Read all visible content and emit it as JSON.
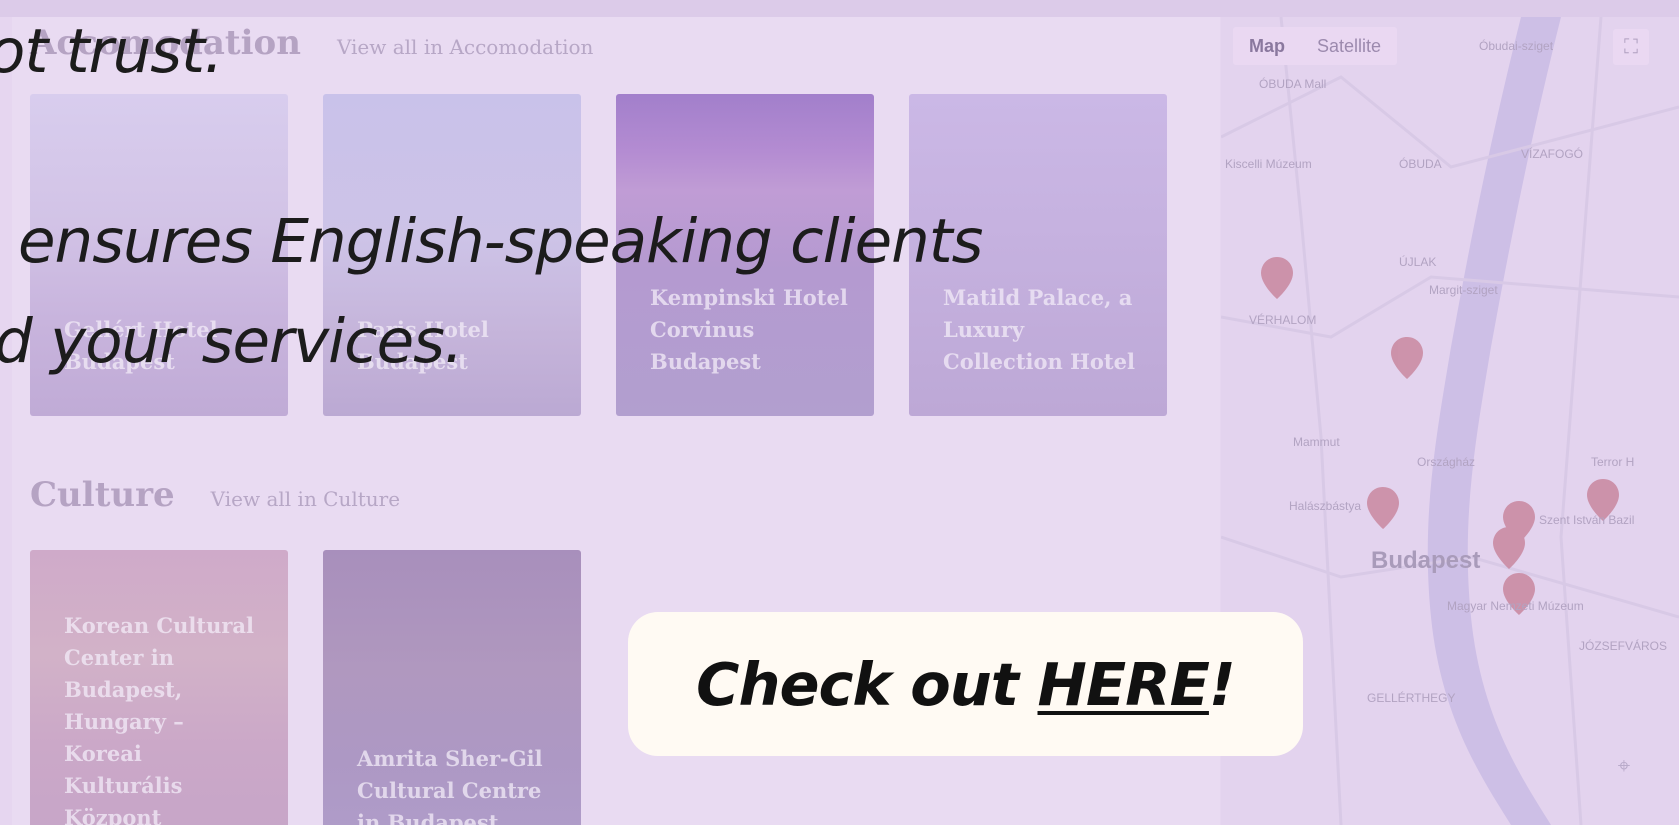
{
  "hero": {
    "line1": "ot trust.",
    "line2": "ensures English-speaking clients",
    "line3": "d your services."
  },
  "cta": {
    "prefix": "Check out ",
    "link": "HERE",
    "suffix": "!"
  },
  "sections": [
    {
      "title": "Accomodation",
      "link": "View all in Accomodation",
      "cards": [
        {
          "label": "Gellért Hotel Budapest"
        },
        {
          "label": "Paris Hotel Budapest"
        },
        {
          "label": "Kempinski Hotel Corvinus Budapest"
        },
        {
          "label": "Matild Palace, a Luxury Collection Hotel"
        }
      ]
    },
    {
      "title": "Culture",
      "link": "View all in Culture",
      "cards": [
        {
          "label": "Korean Cultural Center in Budapest, Hungary – Koreai Kulturális Központ"
        },
        {
          "label": "Amrita Sher-Gil Cultural Centre in Budapest"
        }
      ]
    }
  ],
  "map": {
    "type_map": "Map",
    "type_satellite": "Satellite",
    "city": "Budapest",
    "labels": [
      "ÓBUDA",
      "ÚJLAK",
      "VÉRHALOM",
      "Margit-sziget",
      "Országház",
      "Halászbástya",
      "Szent István Bazil",
      "Magyar Nemzeti Múzeum",
      "GELLÉRTHEGY",
      "JÓZSEFVÁROS",
      "Óbudai-sziget",
      "Mammut",
      "Terror H",
      "ÓBUDA Mall",
      "Kiscelli Múzeum",
      "VÍZAFOGÓ"
    ],
    "fullscreen_icon": "fullscreen-icon",
    "recenter_icon": "recenter-icon"
  },
  "colors": {
    "cta_bg": "#fffaf3",
    "overlay": "#e6d6f0",
    "pin": "#c9879f"
  }
}
